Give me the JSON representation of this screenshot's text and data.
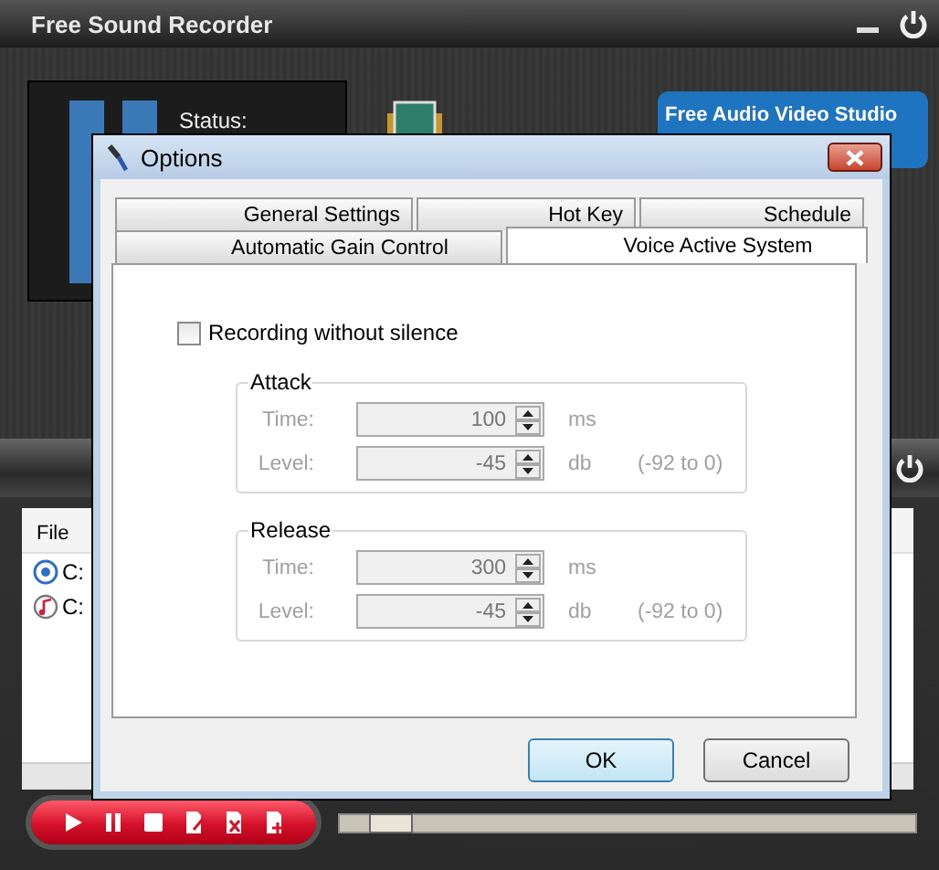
{
  "app": {
    "title": "Free Sound Recorder",
    "status_label": "Status:",
    "promo_button": "Free Audio Video Studio",
    "file_list": {
      "header": "File",
      "rows": [
        {
          "kind": "audio",
          "path": "C:"
        },
        {
          "kind": "music",
          "path": "C:"
        }
      ]
    },
    "progress": {
      "level": 0.05
    }
  },
  "dialog": {
    "title": "Options",
    "tab_rows": [
      {
        "tabs": [
          {
            "label": "General Settings",
            "selected": false
          },
          {
            "label": "Hot Key",
            "selected": false
          },
          {
            "label": "Schedule",
            "selected": false
          }
        ]
      },
      {
        "tabs": [
          {
            "label": "Automatic Gain Control",
            "selected": false
          },
          {
            "label": "Voice Active System",
            "selected": true
          }
        ]
      }
    ],
    "checkbox": {
      "label": "Recording without silence",
      "checked": false
    },
    "groups": [
      {
        "title": "Attack",
        "disabled": true,
        "fields": [
          {
            "label": "Time:",
            "value": "100",
            "unit": "ms"
          },
          {
            "label": "Level:",
            "value": "-45",
            "unit": "db",
            "range": "(-92 to 0)"
          }
        ]
      },
      {
        "title": "Release",
        "disabled": true,
        "fields": [
          {
            "label": "Time:",
            "value": "300",
            "unit": "ms"
          },
          {
            "label": "Level:",
            "value": "-45",
            "unit": "db",
            "range": "(-92 to 0)"
          }
        ]
      }
    ],
    "buttons": [
      {
        "label": "OK",
        "default": true
      },
      {
        "label": "Cancel",
        "default": false
      }
    ]
  }
}
